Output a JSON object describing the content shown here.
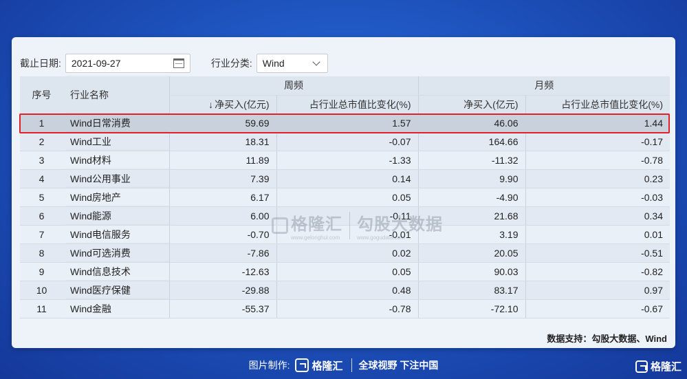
{
  "filters": {
    "date_label": "截止日期:",
    "date_value": "2021-09-27",
    "industry_label": "行业分类:",
    "industry_value": "Wind"
  },
  "table": {
    "headers": {
      "index": "序号",
      "name": "行业名称",
      "weekly_group": "周频",
      "monthly_group": "月频",
      "weekly_net_buy": "净买入(亿元)",
      "weekly_sort_arrow": "↓",
      "weekly_pct": "占行业总市值比变化(%)",
      "monthly_net_buy": "净买入(亿元)",
      "monthly_pct": "占行业总市值比变化(%)"
    },
    "rows": [
      {
        "idx": "1",
        "name": "Wind日常消费",
        "w_buy": "59.69",
        "w_pct": "1.57",
        "m_buy": "46.06",
        "m_pct": "1.44"
      },
      {
        "idx": "2",
        "name": "Wind工业",
        "w_buy": "18.31",
        "w_pct": "-0.07",
        "m_buy": "164.66",
        "m_pct": "-0.17"
      },
      {
        "idx": "3",
        "name": "Wind材料",
        "w_buy": "11.89",
        "w_pct": "-1.33",
        "m_buy": "-11.32",
        "m_pct": "-0.78"
      },
      {
        "idx": "4",
        "name": "Wind公用事业",
        "w_buy": "7.39",
        "w_pct": "0.14",
        "m_buy": "9.90",
        "m_pct": "0.23"
      },
      {
        "idx": "5",
        "name": "Wind房地产",
        "w_buy": "6.17",
        "w_pct": "0.05",
        "m_buy": "-4.90",
        "m_pct": "-0.03"
      },
      {
        "idx": "6",
        "name": "Wind能源",
        "w_buy": "6.00",
        "w_pct": "-0.11",
        "m_buy": "21.68",
        "m_pct": "0.34"
      },
      {
        "idx": "7",
        "name": "Wind电信服务",
        "w_buy": "-0.70",
        "w_pct": "-0.01",
        "m_buy": "3.19",
        "m_pct": "0.01"
      },
      {
        "idx": "8",
        "name": "Wind可选消费",
        "w_buy": "-7.86",
        "w_pct": "0.02",
        "m_buy": "20.05",
        "m_pct": "-0.51"
      },
      {
        "idx": "9",
        "name": "Wind信息技术",
        "w_buy": "-12.63",
        "w_pct": "0.05",
        "m_buy": "90.03",
        "m_pct": "-0.82"
      },
      {
        "idx": "10",
        "name": "Wind医疗保健",
        "w_buy": "-29.88",
        "w_pct": "0.48",
        "m_buy": "83.17",
        "m_pct": "0.97"
      },
      {
        "idx": "11",
        "name": "Wind金融",
        "w_buy": "-55.37",
        "w_pct": "-0.78",
        "m_buy": "-72.10",
        "m_pct": "-0.67"
      }
    ],
    "highlighted_row": "1"
  },
  "source_note": "数据支持：勾股大数据、Wind",
  "watermark": {
    "brand": "格隆汇",
    "brand_url": "www.gelonghui.com",
    "partner": "勾股大数据",
    "partner_url": "www.gogudata.com"
  },
  "footer": {
    "credit_label": "图片制作:",
    "brand": "格隆汇",
    "slogan": "全球视野 下注中国"
  },
  "corner_brand": "格隆汇",
  "colors": {
    "background": "#1c4fb8",
    "highlight_border": "#e0202a",
    "header_bg": "#dde5ef"
  }
}
